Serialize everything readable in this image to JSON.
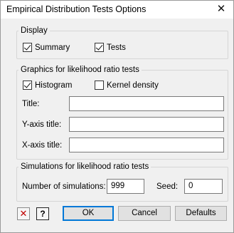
{
  "window": {
    "title": "Empirical Distribution Tests Options",
    "close_symbol": "✕"
  },
  "display": {
    "label": "Display",
    "summary": {
      "label": "Summary",
      "checked": true
    },
    "tests": {
      "label": "Tests",
      "checked": true
    }
  },
  "graphics": {
    "label": "Graphics for likelihood ratio tests",
    "histogram": {
      "label": "Histogram",
      "checked": true
    },
    "kernel_density": {
      "label": "Kernel density",
      "checked": false
    },
    "title_label": "Title:",
    "title_value": "",
    "yaxis_label": "Y-axis title:",
    "yaxis_value": "",
    "xaxis_label": "X-axis title:",
    "xaxis_value": ""
  },
  "simulations": {
    "label": "Simulations for likelihood ratio tests",
    "number_label": "Number of simulations:",
    "number_value": "999",
    "seed_label": "Seed:",
    "seed_value": "0"
  },
  "buttons": {
    "clear_symbol": "✕",
    "help_symbol": "?",
    "ok": "OK",
    "cancel": "Cancel",
    "defaults": "Defaults"
  },
  "colors": {
    "clear_icon": "#c00000",
    "default_button_border": "#0078d7"
  }
}
